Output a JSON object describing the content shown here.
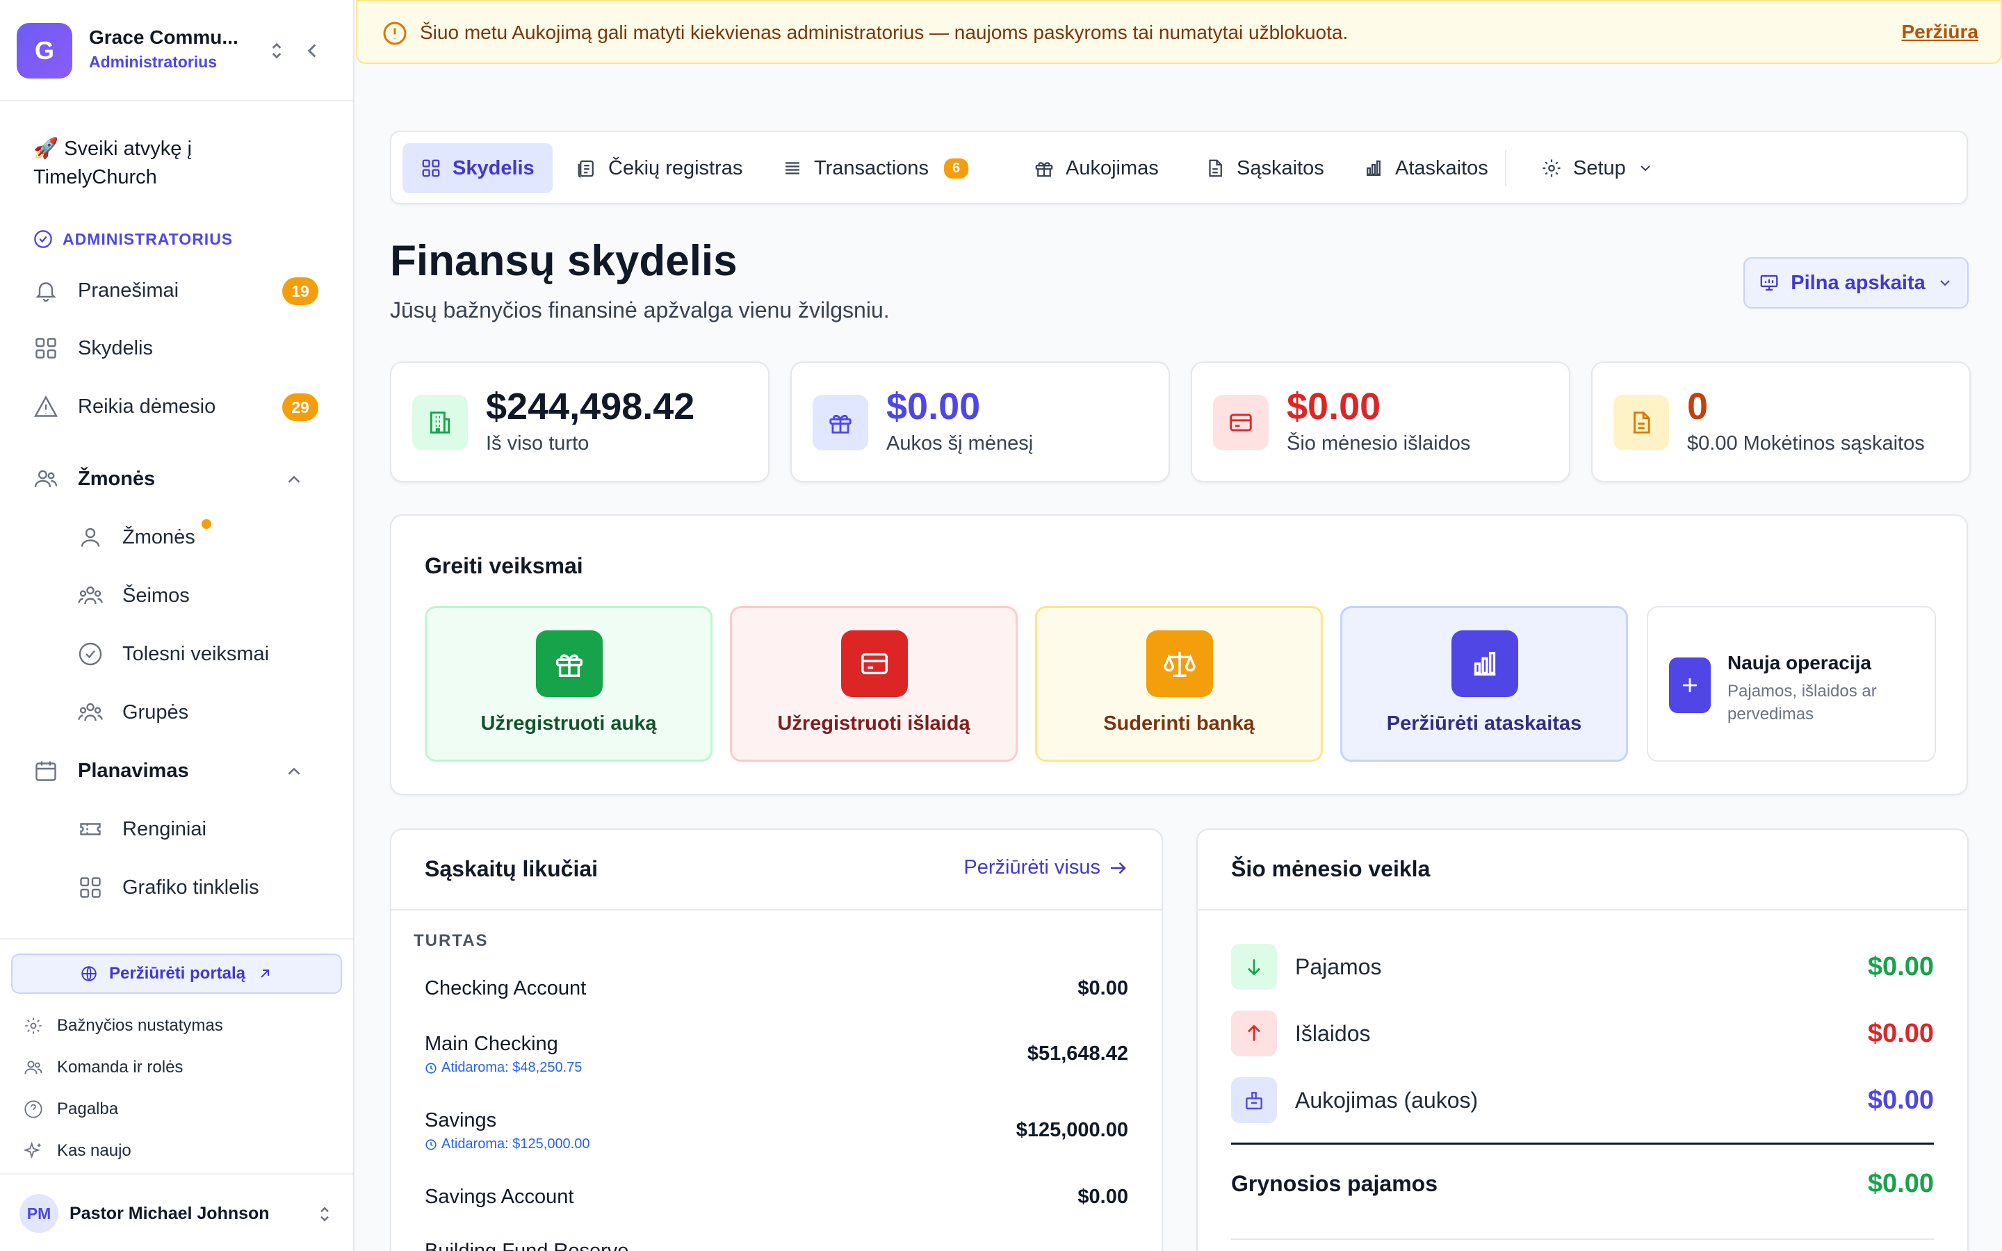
{
  "org": {
    "initial": "G",
    "name": "Grace Commu...",
    "role": "Administratorius"
  },
  "sidebar": {
    "welcome": "🚀 Sveiki atvykę į TimelyChurch",
    "section_admin": "ADMINISTRATORIUS",
    "items": {
      "notifications": {
        "label": "Pranešimai",
        "badge": "19"
      },
      "dashboard": {
        "label": "Skydelis"
      },
      "attention": {
        "label": "Reikia dėmesio",
        "badge": "29"
      },
      "people_group": {
        "label": "Žmonės"
      },
      "people": {
        "label": "Žmonės"
      },
      "families": {
        "label": "Šeimos"
      },
      "followups": {
        "label": "Tolesni veiksmai"
      },
      "groups": {
        "label": "Grupės"
      },
      "planning_group": {
        "label": "Planavimas"
      },
      "events": {
        "label": "Renginiai"
      },
      "schedule_grid": {
        "label": "Grafiko tinklelis"
      }
    },
    "portal_button": "Peržiūrėti portalą",
    "links": {
      "church_settings": "Bažnyčios nustatymas",
      "team_roles": "Komanda ir rolės",
      "help": "Pagalba",
      "whats_new": "Kas naujo"
    },
    "user": {
      "initials": "PM",
      "name": "Pastor Michael Johnson"
    }
  },
  "banner": {
    "text": "Šiuo metu Aukojimą gali matyti kiekvienas administratorius — naujoms paskyroms tai numatytai užblokuota.",
    "link": "Peržiūra"
  },
  "tabs": {
    "dashboard": "Skydelis",
    "checks": "Čekių registras",
    "transactions": "Transactions",
    "transactions_badge": "6",
    "giving": "Aukojimas",
    "accounts": "Sąskaitos",
    "reports": "Ataskaitos",
    "setup": "Setup"
  },
  "header": {
    "title": "Finansų skydelis",
    "subtitle": "Jūsų bažnyčios finansinė apžvalga vienu žvilgsniu.",
    "full_button": "Pilna apskaita"
  },
  "stats": [
    {
      "value": "$244,498.42",
      "label": "Iš viso turto",
      "color": "#111827",
      "icon_bg": "#dcfce7",
      "icon": "building-icon"
    },
    {
      "value": "$0.00",
      "label": "Aukos šį mėnesį",
      "color": "#4f46e5",
      "icon_bg": "#e0e7ff",
      "icon": "gift-icon"
    },
    {
      "value": "$0.00",
      "label": "Šio mėnesio išlaidos",
      "color": "#dc2626",
      "icon_bg": "#fee2e2",
      "icon": "card-icon"
    },
    {
      "value": "0",
      "label": "$0.00 Mokėtinos sąskaitos",
      "color": "#c2410c",
      "icon_bg": "#fef3c7",
      "icon": "document-icon"
    }
  ],
  "quick_actions": {
    "title": "Greiti veiksmai",
    "record_gift": "Užregistruoti auką",
    "record_expense": "Užregistruoti išlaidą",
    "reconcile": "Suderinti banką",
    "view_reports": "Peržiūrėti ataskaitas",
    "new_title": "Nauja operacija",
    "new_sub": "Pajamos, išlaidos ar pervedimas"
  },
  "balances": {
    "title": "Sąskaitų likučiai",
    "view_all": "Peržiūrėti visus",
    "group": "TURTAS",
    "accounts": [
      {
        "name": "Checking Account",
        "sub": "",
        "balance": "$0.00"
      },
      {
        "name": "Main Checking",
        "sub": "Atidaroma: $48,250.75",
        "balance": "$51,648.42"
      },
      {
        "name": "Savings",
        "sub": "Atidaroma: $125,000.00",
        "balance": "$125,000.00"
      },
      {
        "name": "Savings Account",
        "sub": "",
        "balance": "$0.00"
      },
      {
        "name": "Building Fund Reserve",
        "sub": "",
        "balance": ""
      }
    ]
  },
  "activity": {
    "title": "Šio mėnesio veikla",
    "income_label": "Pajamos",
    "income": "$0.00",
    "expense_label": "Išlaidos",
    "expense": "$0.00",
    "giving_label": "Aukojimas (aukos)",
    "giving": "$0.00",
    "net_label": "Grynosios pajamos",
    "net": "$0.00"
  },
  "colors": {
    "accent": "#4f46e5",
    "warning": "#f59e0b",
    "success": "#16a34a",
    "danger": "#dc2626"
  }
}
